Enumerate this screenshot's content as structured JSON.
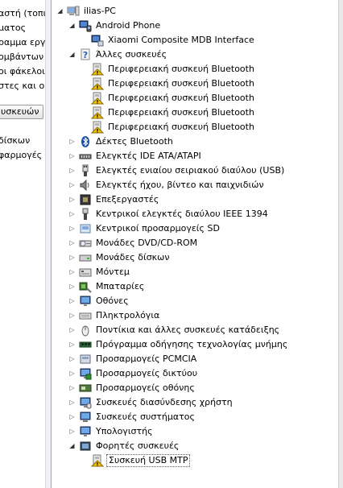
{
  "left_pane": {
    "lines": [
      "αστή (τοπικό",
      "ματος",
      "ραμμα εργασ",
      "ομβάντων",
      "οι φάκελοι",
      "στες και ομ"
    ],
    "button_label": "υσκευών",
    "lines_below": [
      "δίσκων",
      "φαρμογές"
    ]
  },
  "tree": {
    "root": "ilias-PC",
    "categories": [
      {
        "label": "Android Phone",
        "expanded": true,
        "icon": "phone-icon",
        "children": [
          {
            "label": "Xiaomi Composite MDB Interface",
            "icon": "device-icon"
          }
        ]
      },
      {
        "label": "Άλλες συσκευές",
        "expanded": true,
        "icon": "unknown-device-icon",
        "children": [
          {
            "label": "Περιφερειακή συσκευή Bluetooth",
            "icon": "warning-device-icon"
          },
          {
            "label": "Περιφερειακή συσκευή Bluetooth",
            "icon": "warning-device-icon"
          },
          {
            "label": "Περιφερειακή συσκευή Bluetooth",
            "icon": "warning-device-icon"
          },
          {
            "label": "Περιφερειακή συσκευή Bluetooth",
            "icon": "warning-device-icon"
          },
          {
            "label": "Περιφερειακή συσκευή Bluetooth",
            "icon": "warning-device-icon"
          }
        ]
      },
      {
        "label": "Δέκτες Bluetooth",
        "expanded": false,
        "icon": "bluetooth-icon"
      },
      {
        "label": "Ελεγκτές IDE ATA/ATAPI",
        "expanded": false,
        "icon": "ide-controller-icon"
      },
      {
        "label": "Ελεγκτές ενιαίου σειριακού διαύλου (USB)",
        "expanded": false,
        "icon": "usb-icon"
      },
      {
        "label": "Ελεγκτές ήχου, βίντεο και παιχνιδιών",
        "expanded": false,
        "icon": "speaker-icon"
      },
      {
        "label": "Επεξεργαστές",
        "expanded": false,
        "icon": "cpu-icon"
      },
      {
        "label": "Κεντρικοί ελεγκτές διαύλου IEEE 1394",
        "expanded": false,
        "icon": "firewire-icon"
      },
      {
        "label": "Κεντρικοί προσαρμογείς SD",
        "expanded": false,
        "icon": "sd-card-icon"
      },
      {
        "label": "Μονάδες DVD/CD-ROM",
        "expanded": false,
        "icon": "dvd-drive-icon"
      },
      {
        "label": "Μονάδες δίσκων",
        "expanded": false,
        "icon": "disk-drive-icon"
      },
      {
        "label": "Μόντεμ",
        "expanded": false,
        "icon": "modem-icon"
      },
      {
        "label": "Μπαταρίες",
        "expanded": false,
        "icon": "battery-icon"
      },
      {
        "label": "Οθόνες",
        "expanded": false,
        "icon": "monitor-icon"
      },
      {
        "label": "Πληκτρολόγια",
        "expanded": false,
        "icon": "keyboard-icon"
      },
      {
        "label": "Ποντίκια και άλλες συσκευές κατάδειξης",
        "expanded": false,
        "icon": "mouse-icon"
      },
      {
        "label": "Πρόγραμμα οδήγησης τεχνολογίας μνήμης",
        "expanded": false,
        "icon": "memory-icon"
      },
      {
        "label": "Προσαρμογείς PCMCIA",
        "expanded": false,
        "icon": "pcmcia-icon"
      },
      {
        "label": "Προσαρμογείς δικτύου",
        "expanded": false,
        "icon": "network-adapter-icon"
      },
      {
        "label": "Προσαρμογείς οθόνης",
        "expanded": false,
        "icon": "display-adapter-icon"
      },
      {
        "label": "Συσκευές διασύνδεσης χρήστη",
        "expanded": false,
        "icon": "hid-icon"
      },
      {
        "label": "Συσκευές συστήματος",
        "expanded": false,
        "icon": "system-device-icon"
      },
      {
        "label": "Υπολογιστής",
        "expanded": false,
        "icon": "computer-icon"
      },
      {
        "label": "Φορητές συσκευές",
        "expanded": true,
        "icon": "portable-device-icon",
        "children": [
          {
            "label": "Συσκευή USB MTP",
            "icon": "warning-device-icon",
            "selected": true
          }
        ]
      }
    ]
  },
  "colors": {
    "warning": "#f2c200",
    "selection_border": "#555555"
  }
}
